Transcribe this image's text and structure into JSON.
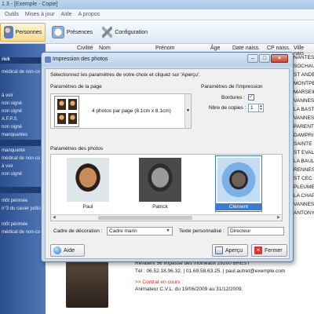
{
  "window": {
    "title": "1.3 - [Exemple - Copie]"
  },
  "menu": [
    "Outils",
    "Mises à jour",
    "Aide",
    "A propos"
  ],
  "toolbar": {
    "personnes": "Personnes",
    "presences": "Présences",
    "configuration": "Configuration"
  },
  "sidebar": {
    "items": [
      "rick",
      "médical de non-co",
      "",
      "à voir",
      "non signé",
      "non signé",
      "A.F.P.S.",
      "non signé",
      "manquantes",
      "",
      "manquante",
      "médical de non-co",
      "à voir",
      "non signé",
      "",
      "ntôt périmée",
      "n°3 du casier judicia",
      "",
      "ntôt périmée",
      "médical de non-co"
    ]
  },
  "grid": {
    "columns": [
      "Civilité",
      "Nom",
      "Prénom",
      "Âge",
      "Date naiss.",
      "CP naiss.",
      "Ville nais"
    ],
    "towns": [
      "NANTES",
      "SOCHAU",
      "ST ANDE",
      "MONTPE",
      "MARSEIL",
      "VANNES",
      "LA BAST",
      "VANNES",
      "PARENT",
      "DAMPRI",
      "SAINTE",
      "ST EVAL",
      "LA BAUL",
      "RENNES",
      "ST CEC",
      "PLEUME",
      "LA CHAP",
      "VANNES",
      "ANTONY"
    ]
  },
  "detail": {
    "address": "Résident 56 impasse des moineaux 29200 BREST",
    "phone": "Tél : 06.52.18.96.32. | 01.69.58.63.25. | paul.autret@exemple.com",
    "contract_label": ">> Contrat en cours :",
    "contract_value": "Animateur C.V.L. du 19/06/2009 au 31/12/2009."
  },
  "dialog": {
    "title": "Impression des photos",
    "instruction": "Sélectionnez les paramètres de votre choix et cliquez sur 'Aperçu'.",
    "page_params_label": "Paramètres de la page",
    "layout_option": "4 photos par page (8.1cm x 8.1cm)",
    "print_params_label": "Paramètres de l'impression",
    "borders_label": "Bordures :",
    "borders_checked": true,
    "copies_label": "Nbre de copies :",
    "copies_value": "1",
    "photo_params_label": "Paramètres des photos",
    "photos": [
      {
        "name": "Paul",
        "selected": false
      },
      {
        "name": "Patrick",
        "selected": false
      },
      {
        "name": "Clément",
        "selected": true
      }
    ],
    "frame_label": "Cadre de décoration :",
    "frame_value": "Cadre marin",
    "custom_text_label": "Texte personnalisé :",
    "custom_text_value": "Directeur",
    "help_button": "Aide",
    "preview_button": "Aperçu",
    "close_button": "Fermer"
  },
  "colors": {
    "sidebar": "#3b5fa0",
    "selection": "#3a7bd5",
    "close": "#c8452c"
  },
  "icons": [
    "personnes-icon",
    "presences-icon",
    "configuration-icon",
    "help-icon",
    "preview-icon",
    "close-icon"
  ]
}
